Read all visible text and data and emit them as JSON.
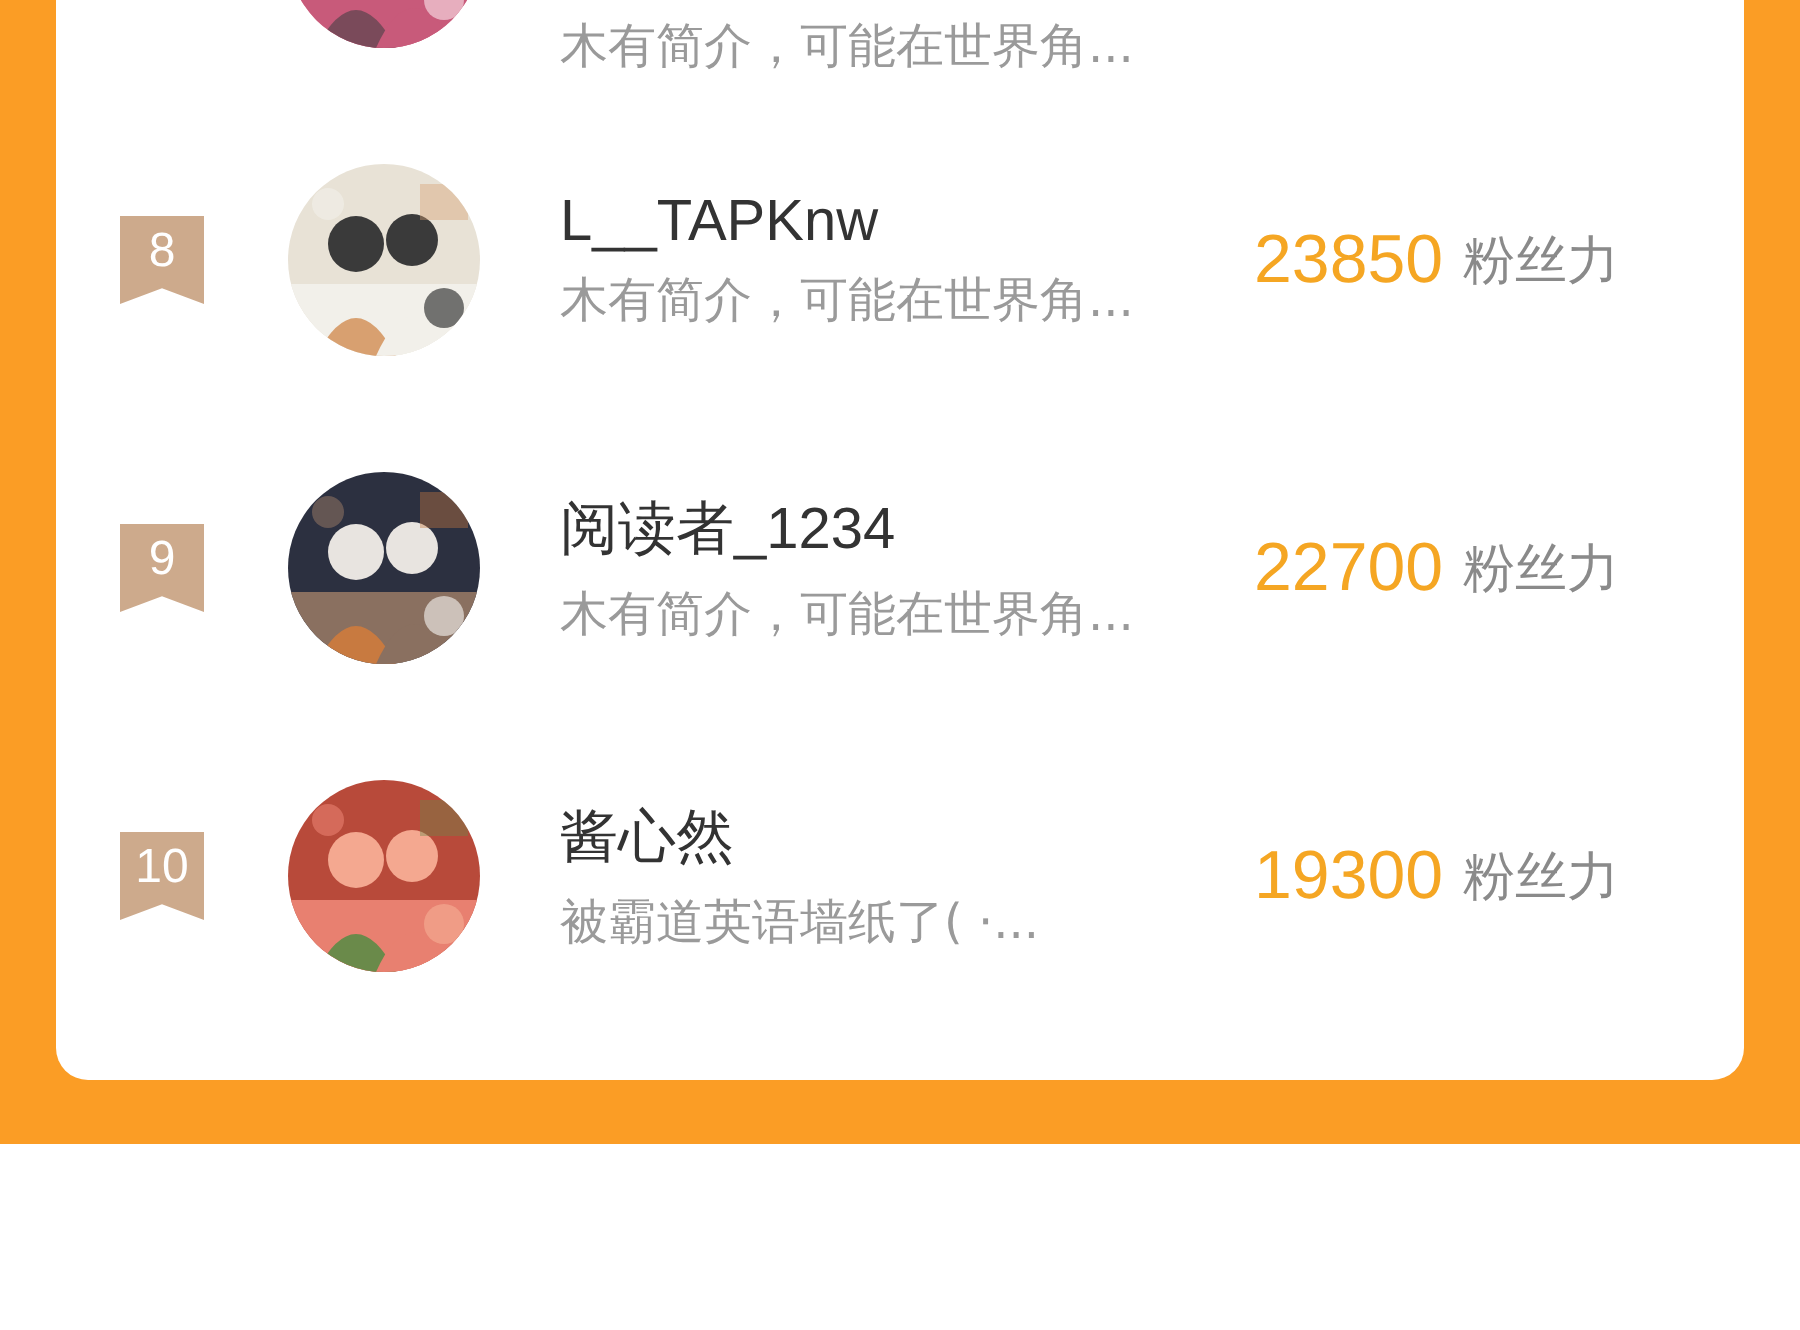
{
  "ranking": [
    {
      "kind": "partial",
      "subtitle": "木有简介，可能在世界角..."
    },
    {
      "kind": "full",
      "rank": "8",
      "name": "L__TAPKnw",
      "subtitle": "木有简介，可能在世界角...",
      "score": "23850",
      "unit": "粉丝力"
    },
    {
      "kind": "full",
      "rank": "9",
      "name": "阅读者_1234",
      "subtitle": "木有简介，可能在世界角...",
      "score": "22700",
      "unit": "粉丝力"
    },
    {
      "kind": "full",
      "rank": "10",
      "name": "酱心然",
      "subtitle": "被霸道英语墙纸了( ·...",
      "score": "19300",
      "unit": "粉丝力"
    }
  ]
}
